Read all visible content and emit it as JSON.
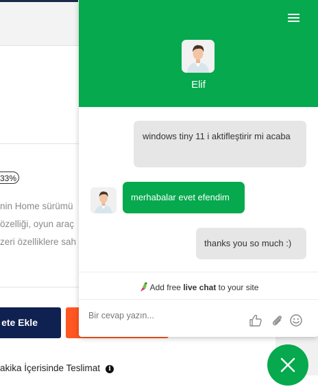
{
  "background": {
    "discount_badge": "33%",
    "description_lines": [
      "nin Home sürümü",
      "özelliği, oyun araç",
      "zeri özelliklere sah"
    ],
    "add_to_cart_label": "ete Ekle",
    "delivery_text": "akika İçerisinde Teslimat",
    "info_icon": "i"
  },
  "chat": {
    "agent": {
      "name": "Elif",
      "avatar": "agent-avatar"
    },
    "messages": [
      {
        "from": "visitor",
        "text": "windows tiny 11 i aktifleştirir mi acaba"
      },
      {
        "from": "agent",
        "text": "merhabalar evet efendim"
      },
      {
        "from": "visitor",
        "text": "thanks you so much :)"
      }
    ],
    "powered_by": {
      "prefix": "Add free ",
      "bold": "live chat",
      "suffix": " to your site"
    },
    "input": {
      "placeholder": "Bir cevap yazın...",
      "value": ""
    },
    "icons": [
      "menu-icon",
      "thumbs-up-icon",
      "paperclip-icon",
      "smiley-icon",
      "close-icon"
    ]
  },
  "colors": {
    "brand_green": "#06a94d",
    "user_bubble": "#e6e6e6",
    "navy": "#0f2150",
    "orange": "#ff5722"
  }
}
